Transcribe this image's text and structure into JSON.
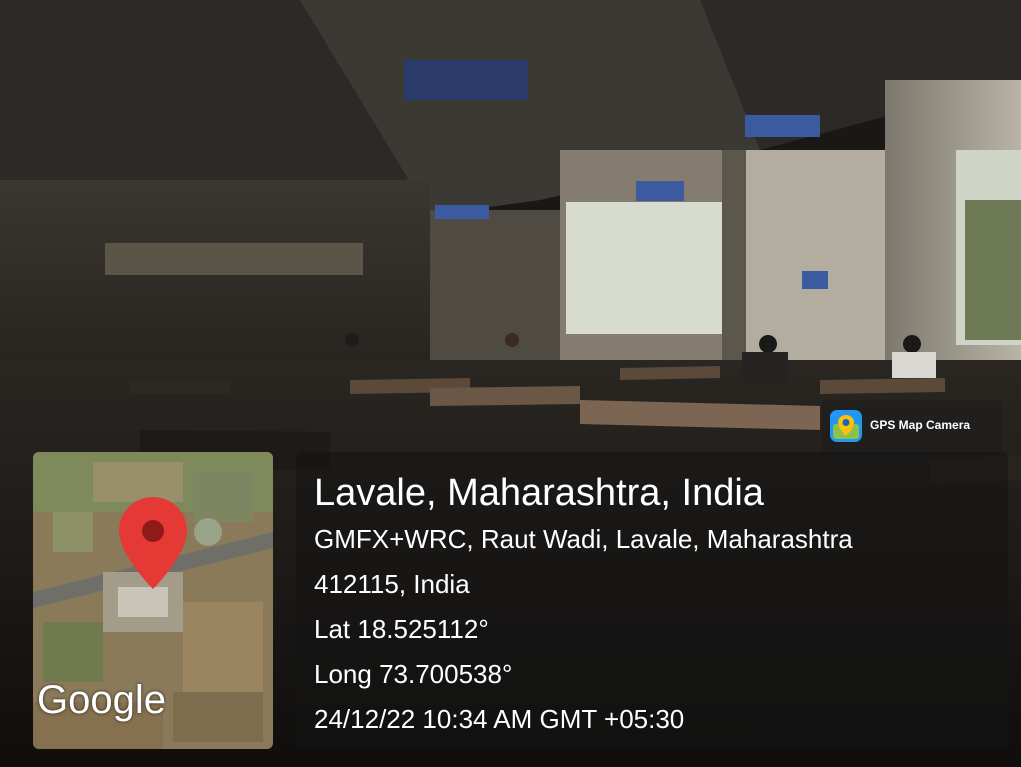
{
  "badge": {
    "label": "GPS Map Camera",
    "icon": "map-pin-app-icon"
  },
  "map": {
    "logo": "Google",
    "pin_color": "#E53935"
  },
  "location": {
    "title": "Lavale, Maharashtra, India",
    "address_line1": "GMFX+WRC, Raut Wadi, Lavale, Maharashtra",
    "address_line2": "412115, India",
    "lat": "Lat 18.525112°",
    "long": "Long 73.700538°",
    "datetime": "24/12/22 10:34 AM GMT +05:30"
  }
}
